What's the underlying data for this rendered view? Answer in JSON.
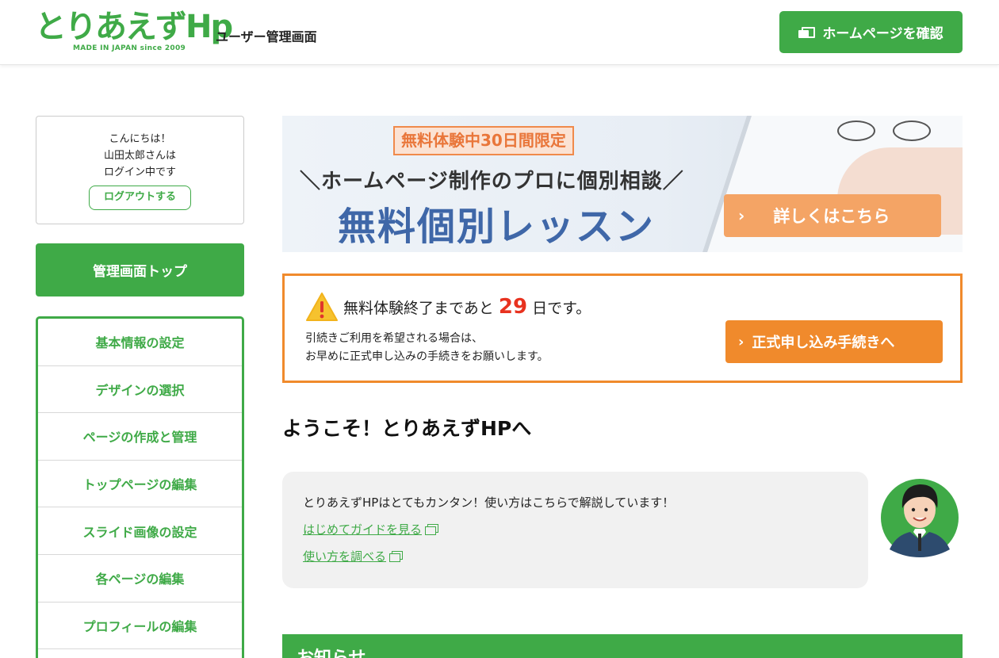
{
  "header": {
    "logo_text": "とりあえずHp",
    "logo_sub": "MADE IN JAPAN since 2009",
    "title": "ユーザー管理画面",
    "home_button": "ホームページを確認"
  },
  "sidebar": {
    "greeting_lines": [
      "こんにちは！",
      "山田太郎さんは",
      "ログイン中です"
    ],
    "logout_button": "ログアウトする",
    "top_button": "管理画面トップ",
    "menu": [
      "基本情報の設定",
      "デザインの選択",
      "ページの作成と管理",
      "トップページの編集",
      "スライド画像の設定",
      "各ページの編集",
      "プロフィールの編集"
    ]
  },
  "banner": {
    "tag": "無料体験中30日間限定",
    "subtitle": "＼ホームページ制作のプロに個別相談／",
    "main": "無料個別レッスン",
    "button": "詳しくはこちら"
  },
  "trial": {
    "prefix": "無料体験終了まであと",
    "days": "29",
    "suffix": "日です。",
    "note_lines": [
      "引続きご利用を希望される場合は、",
      "お早めに正式申し込みの手続きをお願いします。"
    ],
    "button": "正式申し込み手続きへ"
  },
  "welcome": {
    "title": "ようこそ！とりあえずHPへ",
    "text": "とりあえずHPはとてもカンタン！使い方はこちらで解説しています！",
    "links": [
      "はじめてガイドを見る",
      "使い方を調べる"
    ]
  },
  "news": {
    "title": "お知らせ"
  },
  "colors": {
    "brand_green": "#3faa47",
    "accent_orange": "#f08a2c",
    "days_red": "#e8321f"
  }
}
